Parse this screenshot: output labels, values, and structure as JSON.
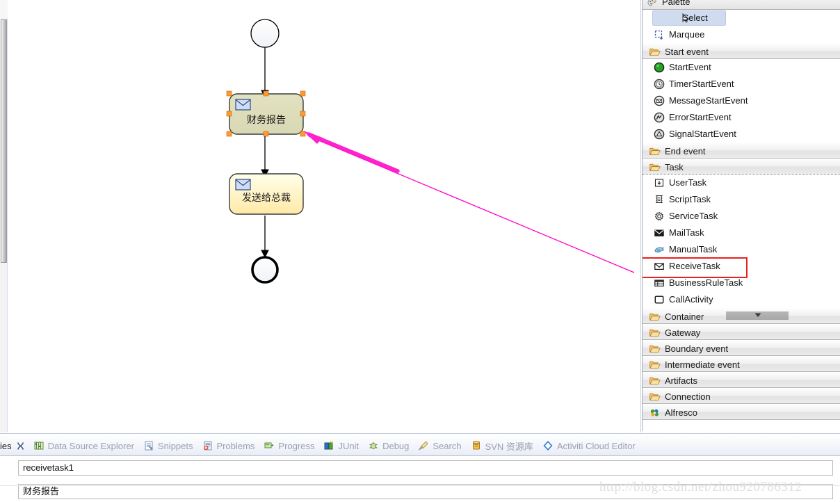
{
  "palette": {
    "title": "Palette",
    "title_icon": "palette-icon",
    "tools": [
      {
        "label": "Select",
        "icon": "cursor-arrow-icon",
        "selected": true
      },
      {
        "label": "Marquee",
        "icon": "marquee-select-icon",
        "selected": false
      }
    ],
    "groups": [
      {
        "label": "Start event",
        "icon": "folder-open-icon",
        "items": [
          {
            "label": "StartEvent",
            "icon": "start-event-icon"
          },
          {
            "label": "TimerStartEvent",
            "icon": "timer-start-event-icon"
          },
          {
            "label": "MessageStartEvent",
            "icon": "message-start-event-icon"
          },
          {
            "label": "ErrorStartEvent",
            "icon": "error-start-event-icon"
          },
          {
            "label": "SignalStartEvent",
            "icon": "signal-start-event-icon"
          }
        ]
      },
      {
        "label": "End event",
        "icon": "folder-open-icon",
        "items": []
      },
      {
        "label": "Task",
        "icon": "folder-open-icon",
        "items": [
          {
            "label": "UserTask",
            "icon": "user-task-icon"
          },
          {
            "label": "ScriptTask",
            "icon": "script-task-icon"
          },
          {
            "label": "ServiceTask",
            "icon": "service-task-icon"
          },
          {
            "label": "MailTask",
            "icon": "mail-task-icon"
          },
          {
            "label": "ManualTask",
            "icon": "manual-task-icon"
          },
          {
            "label": "ReceiveTask",
            "icon": "receive-task-icon",
            "highlighted": true
          },
          {
            "label": "BusinessRuleTask",
            "icon": "business-rule-task-icon"
          },
          {
            "label": "CallActivity",
            "icon": "call-activity-icon"
          }
        ]
      },
      {
        "label": "Container",
        "icon": "folder-open-icon",
        "items": []
      },
      {
        "label": "Gateway",
        "icon": "folder-open-icon",
        "items": []
      },
      {
        "label": "Boundary event",
        "icon": "folder-open-icon",
        "items": []
      },
      {
        "label": "Intermediate event",
        "icon": "folder-open-icon",
        "items": []
      },
      {
        "label": "Artifacts",
        "icon": "folder-open-icon",
        "items": []
      },
      {
        "label": "Connection",
        "icon": "folder-open-icon",
        "items": []
      },
      {
        "label": "Alfresco",
        "icon": "alfresco-icon",
        "items": []
      }
    ],
    "highlight_color": "#e8201f",
    "selection_color": "#cfdcf0"
  },
  "diagram": {
    "start_event": {
      "shape": "circle"
    },
    "tasks": [
      {
        "label": "财务报告",
        "type": "receive-task",
        "selected": true,
        "fill": "#ddddbb"
      },
      {
        "label": "发送给总裁",
        "type": "receive-task",
        "selected": false,
        "fill": "#ffffcc"
      }
    ],
    "end_event": {
      "shape": "circle-thick"
    },
    "annotation_arrow": {
      "color": "#ff00cc",
      "from": "ReceiveTask",
      "to": "财务报告"
    },
    "selection_handle_color": "#ff9933"
  },
  "views": {
    "tabs": [
      {
        "label": "ies",
        "icon": "properties-icon",
        "active": true,
        "closeable": true
      },
      {
        "label": "Data Source Explorer",
        "icon": "data-source-explorer-icon",
        "active": false
      },
      {
        "label": "Snippets",
        "icon": "snippets-icon",
        "active": false
      },
      {
        "label": "Problems",
        "icon": "problems-icon",
        "active": false
      },
      {
        "label": "Progress",
        "icon": "progress-icon",
        "active": false
      },
      {
        "label": "JUnit",
        "icon": "junit-icon",
        "active": false
      },
      {
        "label": "Debug",
        "icon": "debug-icon",
        "active": false
      },
      {
        "label": "Search",
        "icon": "search-icon",
        "active": false
      },
      {
        "label": "SVN 资源库",
        "icon": "svn-repository-icon",
        "active": false
      },
      {
        "label": "Activiti Cloud Editor",
        "icon": "activiti-cloud-editor-icon",
        "active": false
      }
    ]
  },
  "properties": {
    "id_value": "receivetask1",
    "name_value": "财务报告"
  },
  "watermark": "http://blog.csdn.net/zhou920786312"
}
